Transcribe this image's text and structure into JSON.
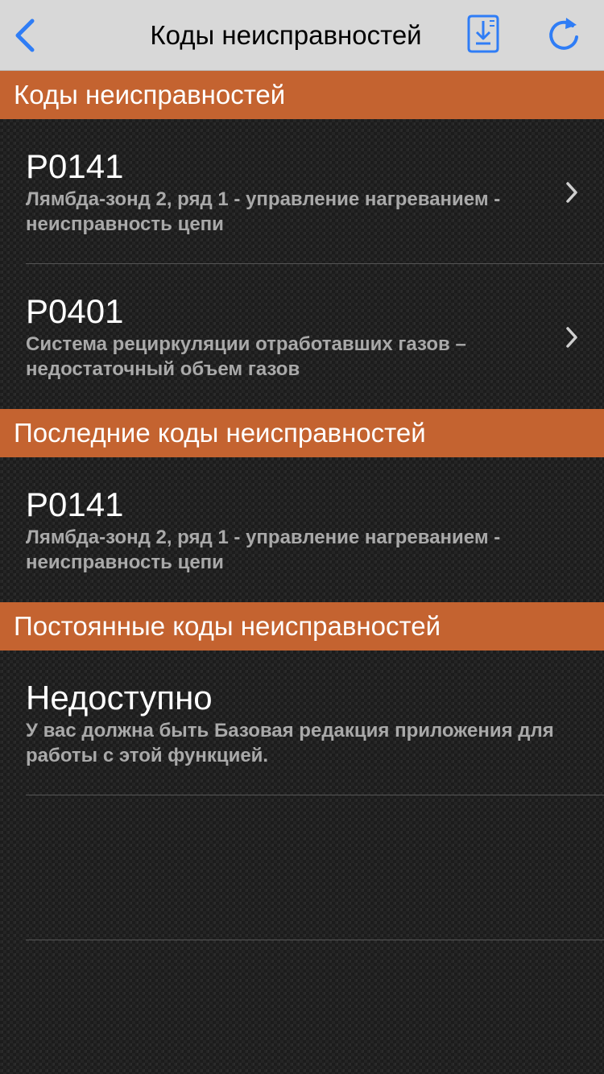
{
  "navbar": {
    "title": "Коды неисправностей",
    "back_icon": "chevron-left-icon",
    "save_icon": "save-download-icon",
    "refresh_icon": "refresh-icon",
    "accent_color": "#2f7df6"
  },
  "sections": [
    {
      "header": "Коды неисправностей",
      "rows": [
        {
          "code": "P0141",
          "description": "Лямбда-зонд 2, ряд 1 - управление нагреванием - неисправность цепи",
          "chevron": true
        },
        {
          "code": "P0401",
          "description": "Система рециркуляции отработавших газов – недостаточный объем газов",
          "chevron": true
        }
      ]
    },
    {
      "header": "Последние коды неисправностей",
      "rows": [
        {
          "code": "P0141",
          "description": "Лямбда-зонд 2, ряд 1 - управление нагреванием - неисправность цепи",
          "chevron": false
        }
      ]
    },
    {
      "header": "Постоянные коды неисправностей",
      "rows": [
        {
          "code": "Недоступно",
          "description": "У вас должна быть Базовая редакция приложения для работы с этой функцией.",
          "chevron": false
        }
      ]
    }
  ],
  "colors": {
    "section_header": "#c46330",
    "navbar_bg": "#d8d8d8",
    "background": "#252525",
    "row_title": "#ffffff",
    "row_description": "#a9a9a9"
  }
}
